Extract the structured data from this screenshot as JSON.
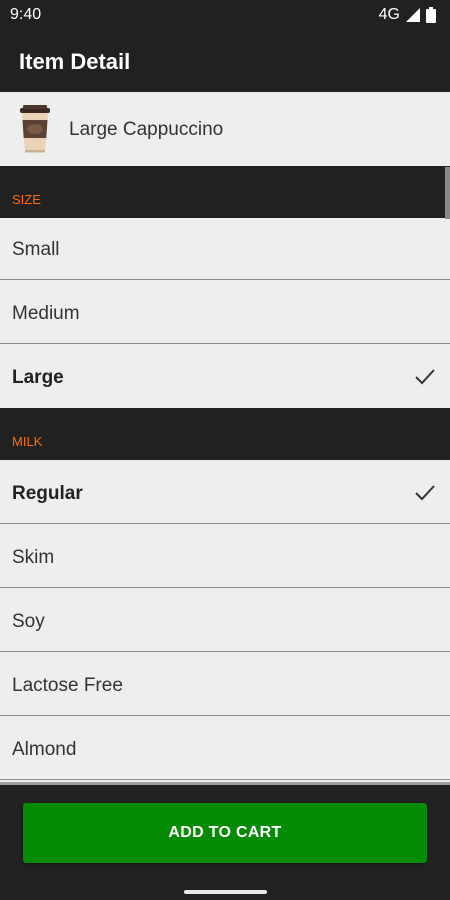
{
  "status_bar": {
    "time": "9:40",
    "network": "4G"
  },
  "app_bar": {
    "title": "Item Detail"
  },
  "product": {
    "name": "Large Cappuccino",
    "image_icon": "coffee-cup-icon"
  },
  "sections": [
    {
      "label": "SIZE",
      "options": [
        {
          "label": "Small",
          "selected": false
        },
        {
          "label": "Medium",
          "selected": false
        },
        {
          "label": "Large",
          "selected": true
        }
      ]
    },
    {
      "label": "MILK",
      "options": [
        {
          "label": "Regular",
          "selected": true
        },
        {
          "label": "Skim",
          "selected": false
        },
        {
          "label": "Soy",
          "selected": false
        },
        {
          "label": "Lactose Free",
          "selected": false
        },
        {
          "label": "Almond",
          "selected": false
        }
      ]
    }
  ],
  "cart_button": {
    "label": "ADD TO CART"
  },
  "colors": {
    "background_dark": "#212121",
    "list_background": "#eeeeee",
    "section_label": "#ff6d00",
    "cart_button": "#068b06"
  },
  "icons": {
    "selected_indicator": "check-icon",
    "signal": "signal-icon",
    "battery": "battery-icon"
  }
}
